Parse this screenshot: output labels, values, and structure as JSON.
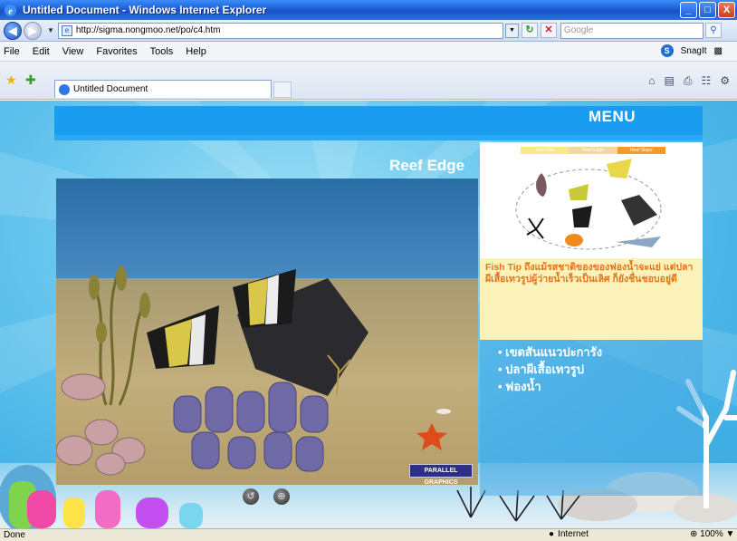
{
  "window": {
    "title": "Untitled Document - Windows Internet Explorer",
    "controls": {
      "minimize": "_",
      "maximize": "□",
      "close": "X"
    }
  },
  "address_bar": {
    "url": "http://sigma.nongmoo.net/po/c4.htm",
    "search_placeholder": "Google",
    "back_icon": "back-arrow",
    "forward_icon": "forward-arrow"
  },
  "menu_bar": {
    "items": [
      "File",
      "Edit",
      "View",
      "Favorites",
      "Tools",
      "Help"
    ],
    "snagit_label": "SnagIt"
  },
  "tab_bar": {
    "tab_label": "Untitled Document"
  },
  "page": {
    "menu_label": "MENU",
    "scene_title": "Reef Edge",
    "mini_tabs": [
      "Reef Flat",
      "Reef Edge",
      "Reef Slope"
    ],
    "fish_tip_label": "Fish Tip",
    "fish_tip_text": "ถึงแม้รสชาติของของฟองน้ำจะแย่ แต่ปลาผีเสื้อเทวรูปผู้ว่ายน้ำเร็วเป็นเลิศ ก็ยังชื่นชอบอยู่ดี",
    "list": [
      "เขตสันแนวปะการัง",
      "ปลาผีเสื้อเทวรูป",
      "ฟองน้ำ"
    ],
    "logo_text": "PARALLEL GRAPHICS"
  },
  "status_bar": {
    "status": "Done",
    "zone": "Internet",
    "zoom": "100%"
  },
  "colors": {
    "menu_band": "#1a9cf0",
    "tip_background": "#fbf2b9",
    "tip_text": "#e4731a",
    "page_background": "#67c6ee"
  }
}
